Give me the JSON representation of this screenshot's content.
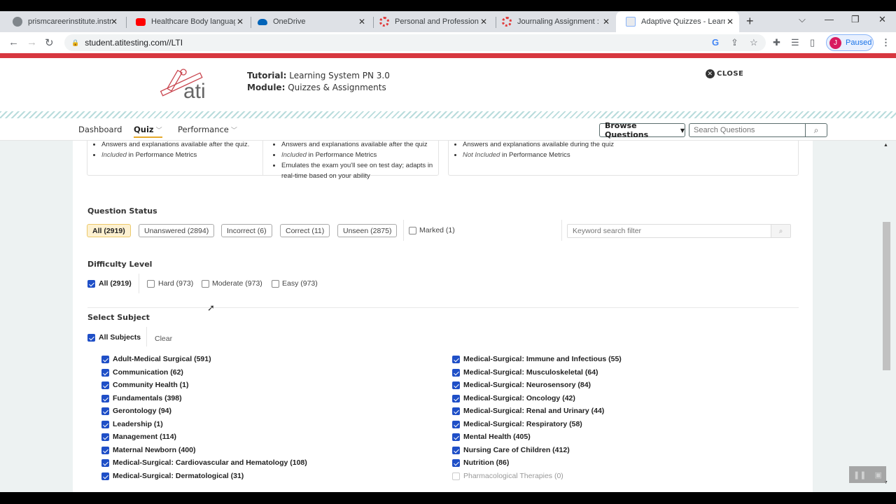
{
  "browser": {
    "tabs": [
      {
        "label": "prismcareerinstitute.instruc",
        "icon": "globe-icon",
        "icon_color": "#80868b",
        "active": false
      },
      {
        "label": "Healthcare Body language",
        "icon": "youtube-icon",
        "icon_color": "#ff0000",
        "active": false
      },
      {
        "label": "OneDrive",
        "icon": "onedrive-icon",
        "icon_color": "#0364b8",
        "active": false
      },
      {
        "label": "Personal and Professional R",
        "icon": "canvas-icon",
        "icon_color": "#e13a3a",
        "active": false
      },
      {
        "label": "Journaling Assignment : Ca",
        "icon": "canvas-icon",
        "icon_color": "#e13a3a",
        "active": false
      },
      {
        "label": "Adaptive Quizzes - Learning",
        "icon": "page-icon",
        "icon_color": "#8ab4f8",
        "active": true
      }
    ],
    "new_tab": "+",
    "url": "student.atitesting.com//LTI",
    "profile_initial": "J",
    "profile_status": "Paused"
  },
  "header": {
    "logo_text": "ati",
    "tutorial_label": "Tutorial:",
    "tutorial_value": "Learning System PN 3.0",
    "module_label": "Module:",
    "module_value": "Quizzes & Assignments",
    "close_label": "CLOSE"
  },
  "subnav": {
    "items": [
      {
        "label": "Dashboard",
        "active": false
      },
      {
        "label": "Quiz",
        "active": true
      },
      {
        "label": "Performance",
        "active": false
      }
    ],
    "browse_label": "Browse Questions",
    "search_placeholder": "Search Questions"
  },
  "cards": {
    "card1": {
      "bullets": [
        {
          "em": "",
          "text": "Answers and explanations available after the quiz."
        },
        {
          "em": "Included",
          "text": " in Performance Metrics"
        }
      ]
    },
    "card2": {
      "bullets": [
        {
          "em": "",
          "text": "Answers and explanations available after the quiz"
        },
        {
          "em": "Included",
          "text": " in Performance Metrics"
        },
        {
          "em": "",
          "text": "Emulates the exam you'll see on test day; adapts in real-time based on your ability"
        }
      ]
    },
    "card3": {
      "bullets": [
        {
          "em": "",
          "text": "Answers and explanations available during the quiz"
        },
        {
          "em": "Not Included",
          "text": " in Performance Metrics"
        }
      ]
    }
  },
  "question_status": {
    "title": "Question Status",
    "pills": [
      {
        "label": "All (2919)",
        "selected": true
      },
      {
        "label": "Unanswered (2894)",
        "selected": false
      },
      {
        "label": "Incorrect (6)",
        "selected": false
      },
      {
        "label": "Correct (11)",
        "selected": false
      },
      {
        "label": "Unseen (2875)",
        "selected": false
      }
    ],
    "marked_label": "Marked (1)",
    "marked_checked": false,
    "keyword_placeholder": "Keyword search filter"
  },
  "difficulty": {
    "title": "Difficulty Level",
    "options": [
      {
        "label": "All (2919)",
        "checked": true
      },
      {
        "label": "Hard (973)",
        "checked": false
      },
      {
        "label": "Moderate (973)",
        "checked": false
      },
      {
        "label": "Easy (973)",
        "checked": false
      }
    ]
  },
  "subjects": {
    "title": "Select Subject",
    "all_label": "All Subjects",
    "all_checked": true,
    "clear_label": "Clear",
    "left": [
      {
        "label": "Adult-Medical Surgical (591)",
        "checked": true
      },
      {
        "label": "Communication (62)",
        "checked": true
      },
      {
        "label": "Community Health (1)",
        "checked": true
      },
      {
        "label": "Fundamentals (398)",
        "checked": true
      },
      {
        "label": "Gerontology (94)",
        "checked": true
      },
      {
        "label": "Leadership (1)",
        "checked": true
      },
      {
        "label": "Management (114)",
        "checked": true
      },
      {
        "label": "Maternal Newborn (400)",
        "checked": true
      },
      {
        "label": "Medical-Surgical: Cardiovascular and Hematology (108)",
        "checked": true
      },
      {
        "label": "Medical-Surgical: Dermatological (31)",
        "checked": true
      }
    ],
    "right": [
      {
        "label": "Medical-Surgical: Immune and Infectious (55)",
        "checked": true
      },
      {
        "label": "Medical-Surgical: Musculoskeletal (64)",
        "checked": true
      },
      {
        "label": "Medical-Surgical: Neurosensory (84)",
        "checked": true
      },
      {
        "label": "Medical-Surgical: Oncology (42)",
        "checked": true
      },
      {
        "label": "Medical-Surgical: Renal and Urinary (44)",
        "checked": true
      },
      {
        "label": "Medical-Surgical: Respiratory (58)",
        "checked": true
      },
      {
        "label": "Mental Health (405)",
        "checked": true
      },
      {
        "label": "Nursing Care of Children (412)",
        "checked": true
      },
      {
        "label": "Nutrition (86)",
        "checked": true
      },
      {
        "label": "Pharmacological Therapies (0)",
        "checked": false,
        "disabled": true
      }
    ]
  }
}
